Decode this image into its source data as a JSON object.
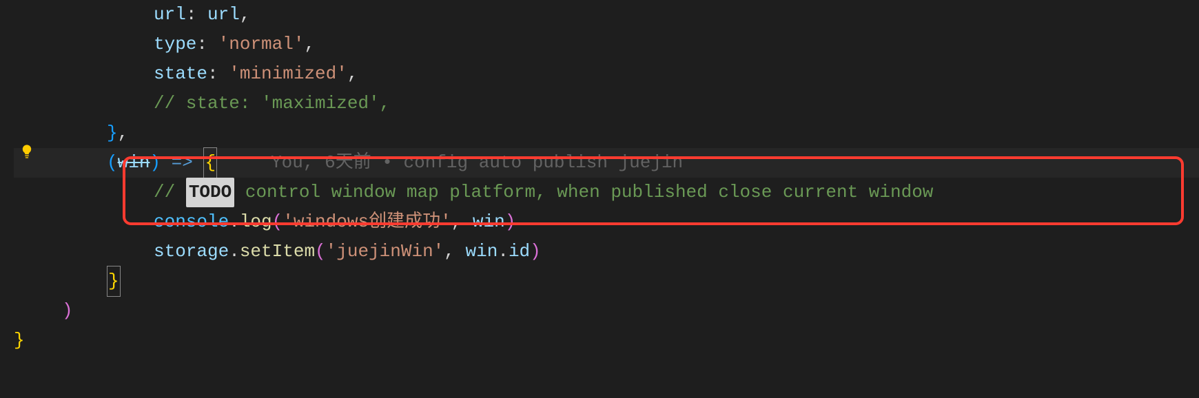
{
  "lines": {
    "l0": {
      "prop": "url",
      "colon": ": ",
      "val": "url",
      "comma": ","
    },
    "l1": {
      "prop": "type",
      "colon": ": ",
      "val": "'normal'",
      "comma": ","
    },
    "l2": {
      "prop": "state",
      "colon": ": ",
      "val": "'minimized'",
      "comma": ","
    },
    "l3": {
      "full": "// state: 'maximized',"
    },
    "l4": {
      "brace": "}",
      "comma": ","
    },
    "l5": {
      "paren_open": "(",
      "param": "win",
      "paren_close": ")",
      "arrow": " => ",
      "brace": "{",
      "annotation": "     You, 6天前 • config auto publish juejin"
    },
    "l6": {
      "comment_start": "// ",
      "todo": "TODO",
      "comment_rest": " control window map platform, when published close current window"
    },
    "l7": {
      "obj": "console",
      "dot": ".",
      "method": "log",
      "paren_open": "(",
      "str": "'windows创建成功'",
      "comma": ", ",
      "var": "win",
      "paren_close": ")"
    },
    "l8": {
      "obj": "storage",
      "dot": ".",
      "method": "setItem",
      "paren_open": "(",
      "str": "'juejinWin'",
      "comma": ", ",
      "var": "win",
      "dot2": ".",
      "prop": "id",
      "paren_close": ")"
    },
    "l9": {
      "brace": "}"
    },
    "l10": {
      "paren": ")"
    },
    "l11": {
      "brace": "}"
    }
  }
}
